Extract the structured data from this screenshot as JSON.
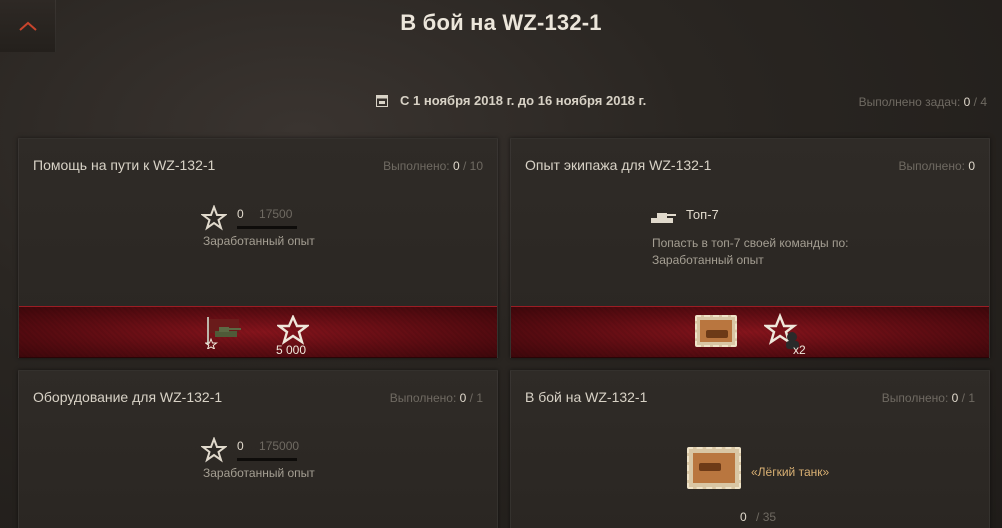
{
  "page": {
    "title": "В бой на WZ-132-1"
  },
  "header": {
    "date_range": "С 1 ноября 2018 г. до 16 ноября 2018 г.",
    "tasks_label": "Выполнено задач:",
    "tasks_done": "0",
    "tasks_sep_total": "/ 4"
  },
  "cards": [
    {
      "title": "Помощь на пути к WZ-132-1",
      "status_label": "Выполнено:",
      "status_done": "0",
      "status_sep_total": "/ 10",
      "condition_value": "0",
      "condition_goal": "17500",
      "condition_progress": 0,
      "condition_label": "Заработанный опыт",
      "reward_amount": "5 000"
    },
    {
      "title": "Опыт экипажа для WZ-132-1",
      "status_label": "Выполнено:",
      "status_done": "0",
      "condition_title": "Топ-7",
      "condition_desc_1": "Попасть в топ-7 своей команды по:",
      "condition_desc_2": "Заработанный опыт",
      "reward_multiplier": "x2"
    },
    {
      "title": "Оборудование для WZ-132-1",
      "status_label": "Выполнено:",
      "status_done": "0",
      "status_sep_total": "/ 1",
      "condition_value": "0",
      "condition_goal": "175000",
      "condition_progress": 0,
      "condition_label": "Заработанный опыт"
    },
    {
      "title": "В бой на WZ-132-1",
      "status_label": "Выполнено:",
      "status_done": "0",
      "status_sep_total": "/ 1",
      "condition_label": "«Лёгкий танк»",
      "progress_value": "0",
      "progress_sep_total": "/ 35"
    }
  ],
  "icons": {
    "back": "chevron-up-icon",
    "calendar": "calendar-icon",
    "xp": "star-icon",
    "top": "tank-silhouette-icon",
    "stamp": "light-tank-stamp-icon",
    "crew": "crew-star-icon"
  },
  "colors": {
    "accent": "#c8442c",
    "reward_red": "#86141c",
    "done_value": "#e0d9cc",
    "muted": "#6f6a62",
    "gold_label": "#d9b073"
  }
}
